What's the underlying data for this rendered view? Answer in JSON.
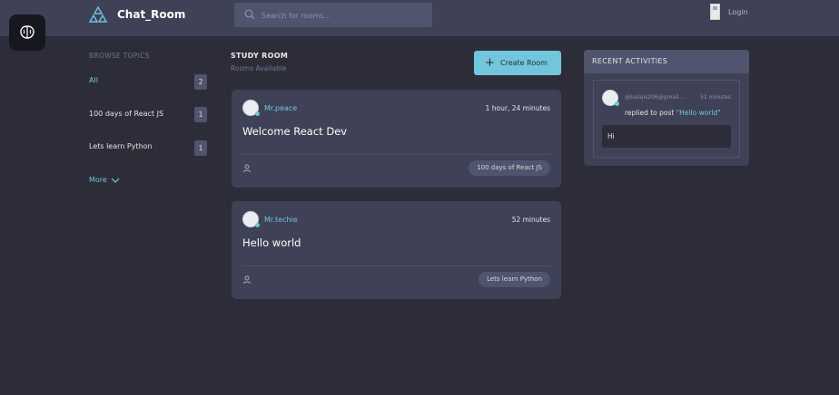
{
  "header": {
    "app_title": "Chat_Room",
    "search_placeholder": "Search for rooms...",
    "login_label": "Login"
  },
  "sidebar": {
    "heading": "BROWSE TOPICS",
    "topics": [
      {
        "label": "All",
        "count": "2"
      },
      {
        "label": "100 days of React JS",
        "count": "1"
      },
      {
        "label": "Lets learn Python",
        "count": "1"
      }
    ],
    "more_label": "More"
  },
  "main": {
    "heading": "STUDY ROOM",
    "subheading": "Rooms Available",
    "create_label": "Create Room",
    "rooms": [
      {
        "host": "Mr.peace",
        "time": "1 hour, 24 minutes",
        "title": "Welcome React Dev",
        "topic": "100 days of React JS"
      },
      {
        "host": "Mr.techie",
        "time": "52 minutes",
        "title": "Hello world",
        "topic": "Lets learn Python"
      }
    ]
  },
  "activity": {
    "heading": "RECENT ACTIVITIES",
    "items": [
      {
        "email": "@balajis206@gmail...",
        "time": "52 minutes",
        "action": "replied to post",
        "post": "\"Hello world\"",
        "message": "Hi"
      }
    ]
  },
  "colors": {
    "background": "#2d2d39",
    "panel": "#3f4156",
    "accent": "#71c6dd"
  },
  "icons": [
    "logo-icon",
    "search-icon",
    "brain-icon",
    "plus-icon",
    "chevron-down-icon",
    "user-icon"
  ]
}
